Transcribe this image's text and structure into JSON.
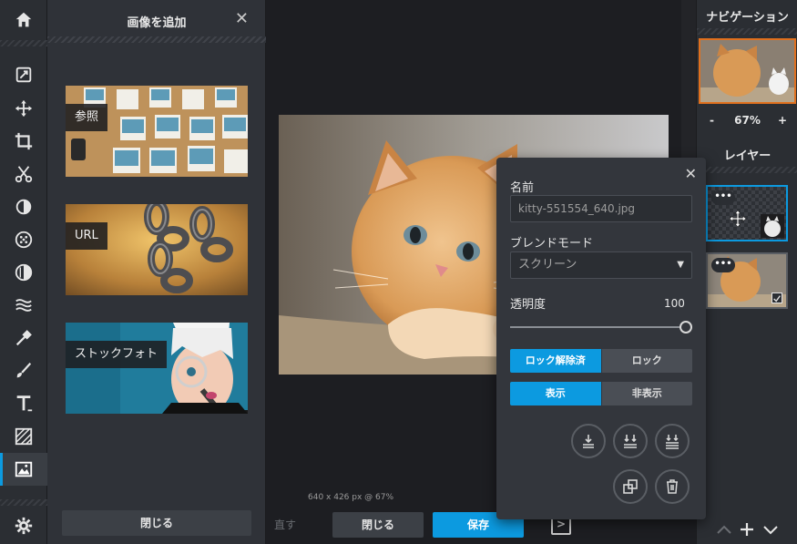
{
  "panel": {
    "title": "画像を追加",
    "close_button": "閉じる"
  },
  "sources": [
    {
      "label": "参照"
    },
    {
      "label": "URL"
    },
    {
      "label": "ストックフォト"
    }
  ],
  "canvas": {
    "status": "640 x 426 px @ 67%"
  },
  "bottom": {
    "redo_partial": "直す",
    "close": "閉じる",
    "save": "保存"
  },
  "navigation": {
    "title": "ナビゲーション",
    "zoom_out": "-",
    "zoom": "67%",
    "zoom_in": "+"
  },
  "layers": {
    "title": "レイヤー"
  },
  "layer_settings": {
    "name_label": "名前",
    "name_value": "kitty-551554_640.jpg",
    "blend_label": "ブレンドモード",
    "blend_value": "スクリーン",
    "opacity_label": "透明度",
    "opacity_value": "100",
    "opacity_fraction": 1.0,
    "unlocked": "ロック解除済",
    "lock": "ロック",
    "show": "表示",
    "hide": "非表示"
  },
  "colors": {
    "accent": "#0c9ae0",
    "nav_border": "#e0701e"
  }
}
